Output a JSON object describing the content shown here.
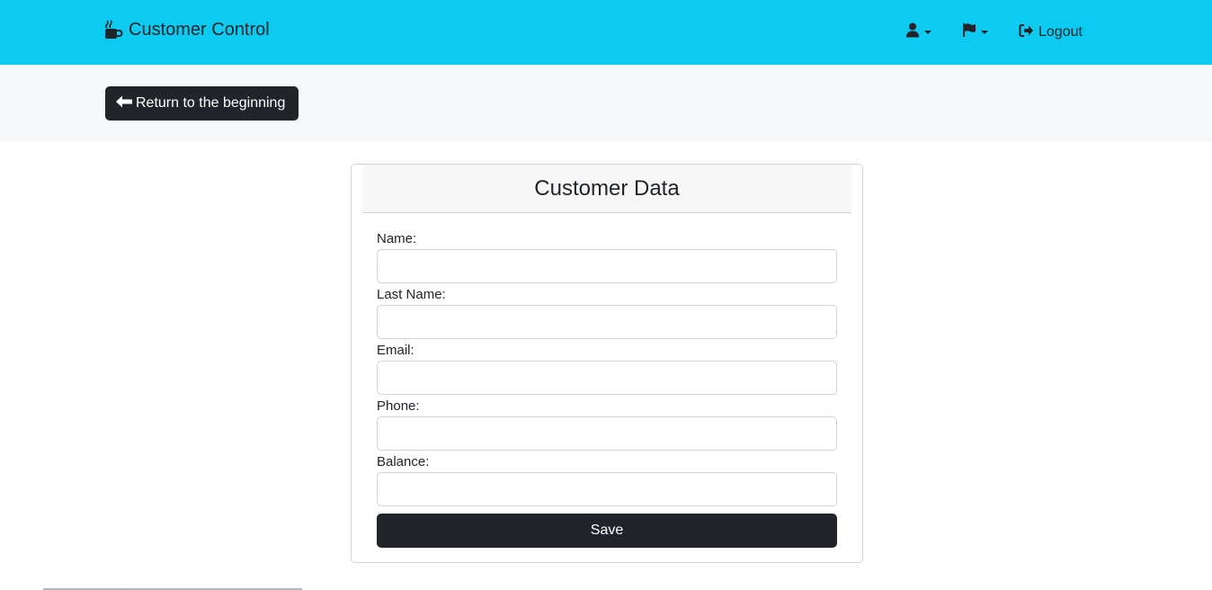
{
  "navbar": {
    "brand_label": "Customer Control",
    "brand_icon": "mug-hot-icon",
    "user_icon": "user-icon",
    "language_icon": "flag-icon",
    "logout_label": "Logout",
    "logout_icon": "sign-out-icon",
    "background": "#0dcaf0"
  },
  "subbar": {
    "return_label": "Return to the beginning",
    "return_icon": "arrow-left-icon"
  },
  "form": {
    "title": "Customer Data",
    "fields": [
      {
        "label": "Name:",
        "value": ""
      },
      {
        "label": "Last Name:",
        "value": ""
      },
      {
        "label": "Email:",
        "value": ""
      },
      {
        "label": "Phone:",
        "value": ""
      },
      {
        "label": "Balance:",
        "value": ""
      }
    ],
    "save_label": "Save"
  },
  "colors": {
    "dark_button": "#212529",
    "accent": "#0dcaf0",
    "subbar_bg": "#f8f9fa"
  }
}
